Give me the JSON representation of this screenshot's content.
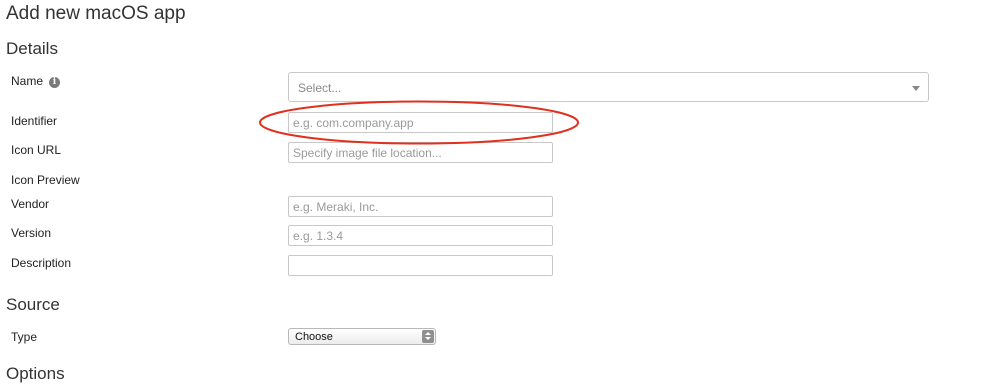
{
  "page": {
    "title": "Add new macOS app"
  },
  "sections": {
    "details": "Details",
    "source": "Source",
    "options": "Options"
  },
  "fields": {
    "name": {
      "label": "Name",
      "placeholder": "Select...",
      "icon": "info-icon"
    },
    "identifier": {
      "label": "Identifier",
      "placeholder": "e.g. com.company.app",
      "value": ""
    },
    "icon_url": {
      "label": "Icon URL",
      "placeholder": "Specify image file location...",
      "value": ""
    },
    "icon_preview": {
      "label": "Icon Preview"
    },
    "vendor": {
      "label": "Vendor",
      "placeholder": "e.g. Meraki, Inc.",
      "value": ""
    },
    "version": {
      "label": "Version",
      "placeholder": "e.g. 1.3.4",
      "value": ""
    },
    "description": {
      "label": "Description",
      "placeholder": "",
      "value": ""
    },
    "type": {
      "label": "Type",
      "selected": "Choose"
    }
  },
  "annotation": {
    "color": "#e0301e"
  }
}
